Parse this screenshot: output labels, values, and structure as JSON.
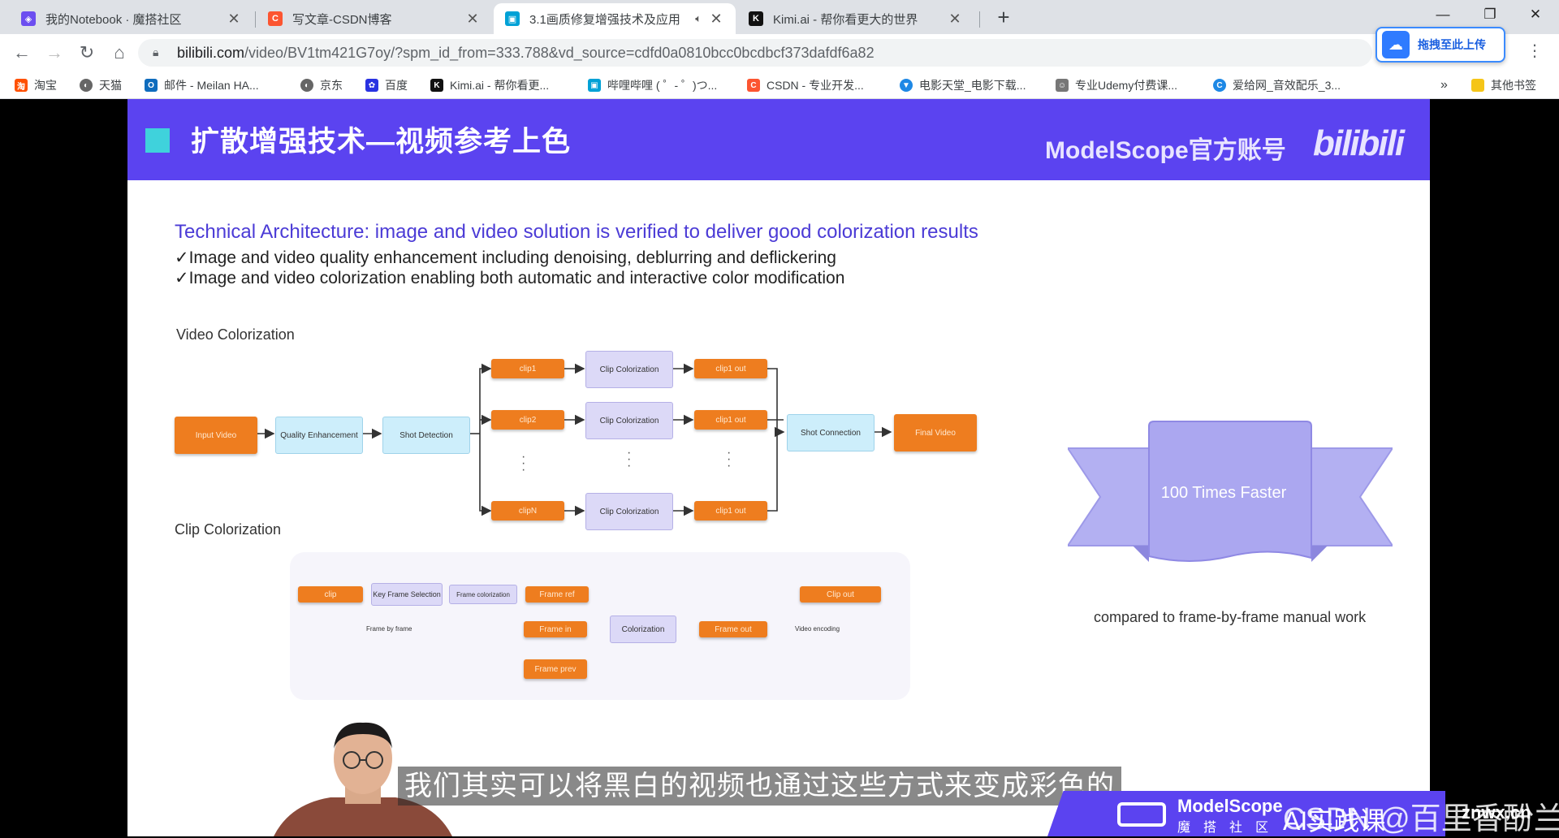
{
  "tabs": [
    {
      "title": "我的Notebook · 魔搭社区",
      "icon": "modelscope-icon",
      "color": "#6c4ef0",
      "active": false
    },
    {
      "title": "写文章-CSDN博客",
      "icon": "csdn-icon",
      "color": "#fc5531",
      "active": false
    },
    {
      "title": "3.1画质修复增强技术及应用",
      "icon": "bilibili-icon",
      "color": "#00a1d6",
      "active": true
    },
    {
      "title": "Kimi.ai - 帮你看更大的世界",
      "icon": "kimi-icon",
      "color": "#111111",
      "active": false
    }
  ],
  "address_bar": {
    "host": "bilibili.com",
    "path": "/video/BV1tm421G7oy/?spm_id_from=333.788&vd_source=cdfd0a0810bcc0bcdbcf373dafdf6a82"
  },
  "upload_button": "拖拽至此上传",
  "bookmarks": [
    {
      "label": "淘宝",
      "icon": "taobao-icon",
      "color": "#ff5000"
    },
    {
      "label": "天猫",
      "icon": "tmall-icon",
      "color": "#666666"
    },
    {
      "label": "邮件 - Meilan HA...",
      "icon": "outlook-icon",
      "color": "#0f6cbd"
    },
    {
      "label": "京东",
      "icon": "jd-icon",
      "color": "#666666"
    },
    {
      "label": "百度",
      "icon": "baidu-icon",
      "color": "#2932e1"
    },
    {
      "label": "Kimi.ai - 帮你看更...",
      "icon": "kimi-icon",
      "color": "#111111"
    },
    {
      "label": "哔哩哔哩 ( ゜- ゜)つ...",
      "icon": "bilibili-icon",
      "color": "#00a1d6"
    },
    {
      "label": "CSDN - 专业开发...",
      "icon": "csdn-icon",
      "color": "#fc5531"
    },
    {
      "label": "电影天堂_电影下载...",
      "icon": "shield-icon",
      "color": "#1e88e5"
    },
    {
      "label": "专业Udemy付费课...",
      "icon": "users-icon",
      "color": "#777777"
    },
    {
      "label": "爱给网_音效配乐_3...",
      "icon": "aigei-icon",
      "color": "#1e88e5"
    }
  ],
  "bookmarks_more": "»",
  "other_bookmarks": "其他书签",
  "slide": {
    "title": "扩散增强技术—视频参考上色",
    "brand": "ModelScope官方账号",
    "bili_logo": "bilibili",
    "tech_title": "Technical Architecture: image and video solution is verified to deliver good colorization results",
    "bullets": [
      "✓Image and video quality enhancement including denoising, deblurring and deflickering",
      "✓Image and video colorization enabling both automatic and interactive color modification"
    ],
    "video_colorization": {
      "label": "Video Colorization",
      "input": "Input Video",
      "quality": "Quality Enhancement",
      "shot_detection": "Shot Detection",
      "clips": [
        "clip1",
        "clip2",
        "clipN"
      ],
      "colorization": "Clip Colorization",
      "outs": [
        "clip1 out",
        "clip1 out",
        "clip1 out"
      ],
      "shot_connection": "Shot Connection",
      "final": "Final Video"
    },
    "clip_colorization": {
      "label": "Clip Colorization",
      "clip": "clip",
      "key_frame": "Key Frame Selection",
      "frame_colorization": "Frame colorization",
      "frame_ref": "Frame ref",
      "frame_in": "Frame in",
      "frame_prev": "Frame prev",
      "colorization": "Colorization",
      "frame_out": "Frame out",
      "clip_out": "Clip out",
      "frame_by_frame": "Frame by frame",
      "video_encoding": "Video encoding"
    },
    "ribbon_text": "100 Times Faster",
    "ribbon_caption": "compared to frame-by-frame manual work"
  },
  "subtitle": "我们其实可以将黑白的视频也通过这些方式来变成彩色的",
  "banner": {
    "logo": "ModelScope",
    "sub": "魔搭社区",
    "ai": "AI实践课"
  },
  "watermark": "CSDN @百里香酚兰",
  "watermark2": "znwx.cn"
}
